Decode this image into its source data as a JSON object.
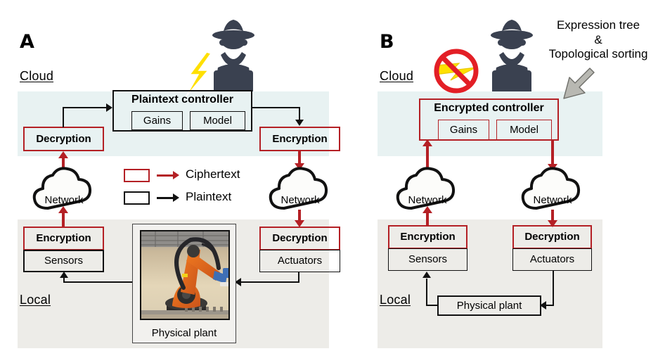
{
  "figure": {
    "panels": [
      {
        "letter": "A",
        "zones": {
          "cloud": "Cloud",
          "local": "Local"
        },
        "controller": {
          "title": "Plaintext controller",
          "style": "plaintext",
          "children": [
            "Gains",
            "Model"
          ]
        },
        "blocks": {
          "left_cloud": "Decryption",
          "right_cloud": "Encryption",
          "left_local_top": "Encryption",
          "left_local_bottom": "Sensors",
          "right_local_top": "Decryption",
          "right_local_bottom": "Actuators"
        },
        "clouds": [
          "Network",
          "Network"
        ],
        "plant": {
          "caption": "Physical plant",
          "kind": "photo-robot-arm"
        },
        "attacker": {
          "icon": "spy-laptop-icon",
          "attack": "lightning-bolt-icon",
          "blocked": false
        }
      },
      {
        "letter": "B",
        "zones": {
          "cloud": "Cloud",
          "local": "Local"
        },
        "controller": {
          "title": "Encrypted controller",
          "style": "encrypted",
          "children": [
            "Gains",
            "Model"
          ]
        },
        "blocks": {
          "left_local_top": "Encryption",
          "left_local_bottom": "Sensors",
          "right_local_top": "Decryption",
          "right_local_bottom": "Actuators"
        },
        "clouds": [
          "Network",
          "Network"
        ],
        "plant": {
          "caption": "Physical plant",
          "kind": "box"
        },
        "attacker": {
          "icon": "spy-laptop-icon",
          "attack": "lightning-bolt-icon",
          "blocked": true,
          "blocked_icon": "no-entry-icon"
        },
        "annotation": {
          "line1": "Expression tree",
          "line2": "&",
          "line3": "Topological sorting",
          "arrow": "gray-arrow-icon"
        }
      }
    ],
    "legend": {
      "items": [
        {
          "label": "Ciphertext",
          "color": "#b42025"
        },
        {
          "label": "Plaintext",
          "color": "#111111"
        }
      ]
    },
    "colors": {
      "ciphertext": "#b42025",
      "plaintext": "#111111",
      "cloud_band": "#e8f2f2",
      "local_band": "#edece8",
      "attacker": "#3a4150",
      "bolt": "#ffe000",
      "anno_arrow": "#b8b8b2"
    }
  }
}
